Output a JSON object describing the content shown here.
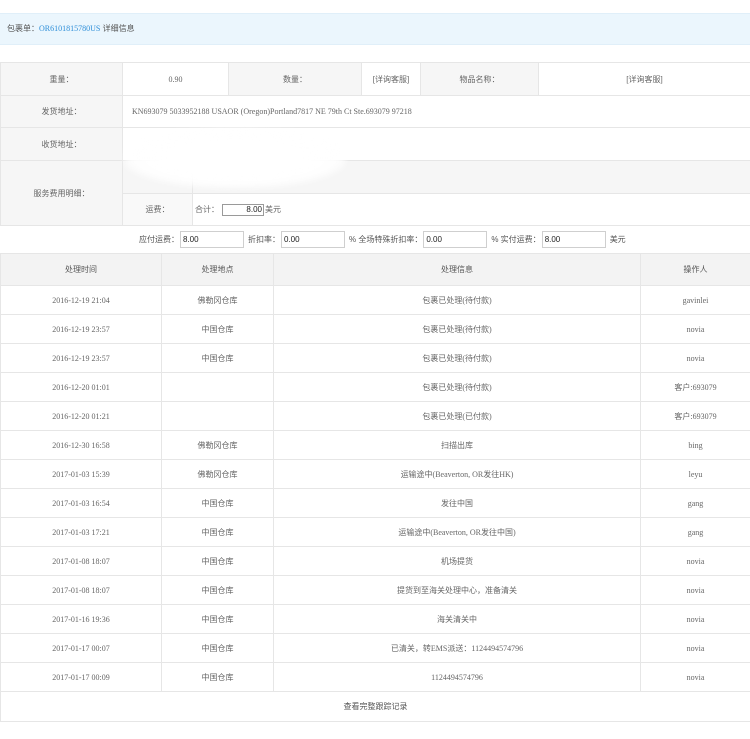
{
  "header": {
    "prefix": "包裹单：",
    "order_no": "OR6101815780US",
    "suffix": "详细信息"
  },
  "info": {
    "weight_label": "重量：",
    "weight_value": "0.90",
    "quantity_label": "数量：",
    "quantity_value": "[详询客服]",
    "item_name_label": "物品名称：",
    "item_name_value": "[详询客服]",
    "ship_from_label": "发货地址：",
    "ship_from_value": "KN693079 5033952188 USAOR (Oregon)Portland7817 NE 79th Ct Ste.693079 97218",
    "ship_to_label": "收货地址：",
    "fee_detail_label": "服务费用明细：",
    "freight_label": "运费：",
    "total_label": "合计：",
    "total_value": "8.00",
    "total_unit": "美元"
  },
  "fees": {
    "payable_label": "应付运费：",
    "payable_value": "8.00",
    "discount_label": "折扣率：",
    "discount_value": "0.00",
    "special_discount_label": "% 全场特殊折扣率：",
    "special_discount_value": "0.00",
    "actual_label": "% 实付运费：",
    "actual_value": "8.00",
    "unit": "美元"
  },
  "tracking": {
    "headers": {
      "time": "处理时间",
      "place": "处理地点",
      "info": "处理信息",
      "operator": "操作人"
    },
    "rows": [
      {
        "time": "2016-12-19 21:04",
        "place": "佛勒冈仓库",
        "info": "包裹已处理(待付款)",
        "operator": "gavinlei"
      },
      {
        "time": "2016-12-19 23:57",
        "place": "中国仓库",
        "info": "包裹已处理(待付款)",
        "operator": "novia"
      },
      {
        "time": "2016-12-19 23:57",
        "place": "中国仓库",
        "info": "包裹已处理(待付款)",
        "operator": "novia"
      },
      {
        "time": "2016-12-20 01:01",
        "place": "",
        "info": "包裹已处理(待付款)",
        "operator": "客户:693079"
      },
      {
        "time": "2016-12-20 01:21",
        "place": "",
        "info": "包裹已处理(已付款)",
        "operator": "客户:693079"
      },
      {
        "time": "2016-12-30 16:58",
        "place": "佛勒冈仓库",
        "info": "扫描出库",
        "operator": "bing"
      },
      {
        "time": "2017-01-03 15:39",
        "place": "佛勒冈仓库",
        "info": "运输途中(Beaverton, OR发往HK)",
        "operator": "leyu"
      },
      {
        "time": "2017-01-03 16:54",
        "place": "中国仓库",
        "info": "发往中国",
        "operator": "gang"
      },
      {
        "time": "2017-01-03 17:21",
        "place": "中国仓库",
        "info": "运输途中(Beaverton, OR发往中国)",
        "operator": "gang"
      },
      {
        "time": "2017-01-08 18:07",
        "place": "中国仓库",
        "info": "机场提货",
        "operator": "novia"
      },
      {
        "time": "2017-01-08 18:07",
        "place": "中国仓库",
        "info": "提货到至海关处理中心，准备清关",
        "operator": "novia"
      },
      {
        "time": "2017-01-16 19:36",
        "place": "中国仓库",
        "info": "海关清关中",
        "operator": "novia"
      },
      {
        "time": "2017-01-17 00:07",
        "place": "中国仓库",
        "info": "已清关，转EMS派送：1124494574796",
        "operator": "novia"
      },
      {
        "time": "2017-01-17 00:09",
        "place": "中国仓库",
        "info": "1124494574796",
        "operator": "novia"
      }
    ],
    "footer_link": "查看完整跟踪记录"
  },
  "colors": {
    "accent": "#2d8ed8",
    "title_bar_bg": "#ebf6fd",
    "label_bg": "#f6f6f6",
    "border": "#e6e6e6"
  }
}
